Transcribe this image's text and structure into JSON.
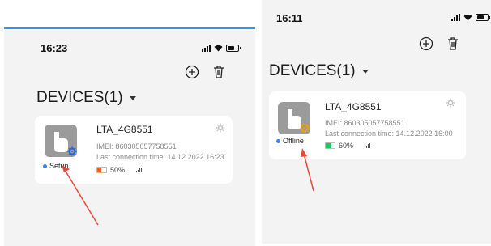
{
  "colors": {
    "accent_blue": "#2f9be6",
    "status_dot": "#3b82f6",
    "battery_orange": "#f0611f",
    "battery_green": "#22c55e",
    "arrow_red": "#e84a3a"
  },
  "left_phone": {
    "time": "16:23",
    "title": "DEVICES(1)",
    "device": {
      "name": "LTA_4G8551",
      "imei": "IMEI: 860305057758551",
      "last_connection": "Last connection time: 14.12.2022 16:23",
      "status": "Setup",
      "battery": "50%",
      "battery_level": 0.5,
      "badge_icon": "gear-badge-icon"
    }
  },
  "right_phone": {
    "time": "16:11",
    "title": "DEVICES(1)",
    "device": {
      "name": "LTA_4G8551",
      "imei": "IMEI: 860305057758551",
      "last_connection": "Last connection time: 14.12.2022 16:00",
      "status": "Offline",
      "battery": "60%",
      "battery_level": 0.6,
      "badge_icon": "prohibited-badge-icon"
    }
  }
}
